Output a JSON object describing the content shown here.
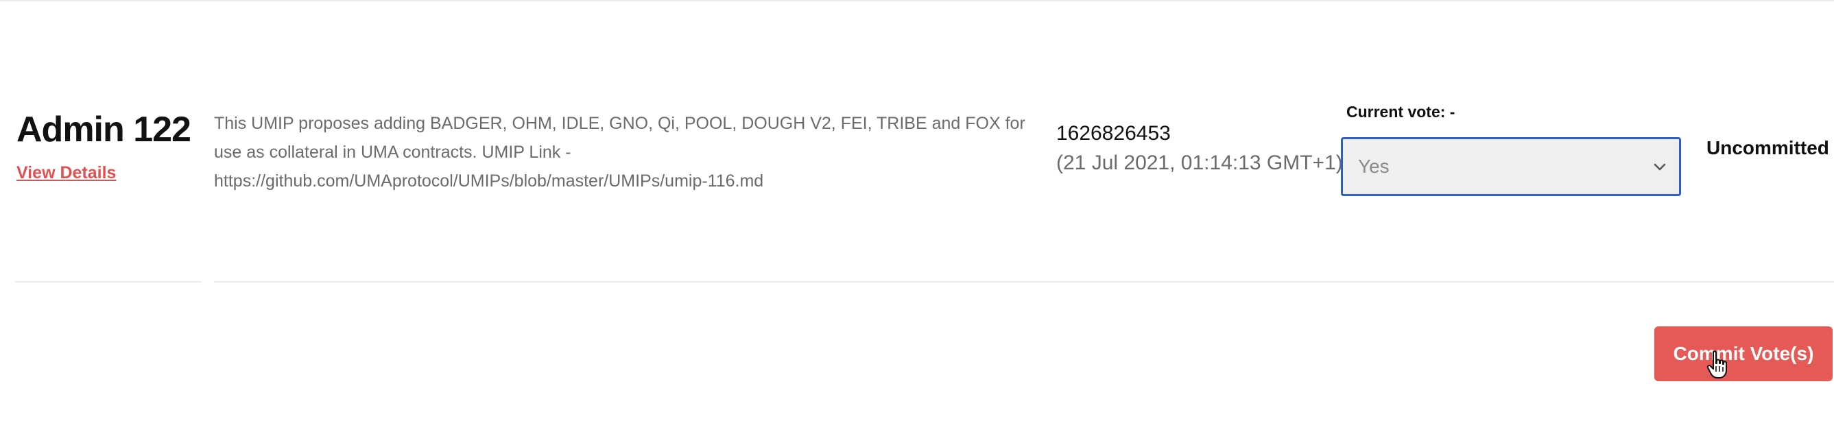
{
  "vote": {
    "title": "Admin 122",
    "view_details_label": "View Details",
    "description_lines": [
      "This UMIP proposes adding BADGER, OHM, IDLE, GNO, Qi, POOL, DOUGH V2, FEI, TRIBE and FOX for",
      "use as collateral in UMA contracts. UMIP Link -",
      "https://github.com/UMAprotocol/UMIPs/blob/master/UMIPs/umip-116.md"
    ],
    "timestamp": "1626826453",
    "timestamp_readable": "(21 Jul 2021, 01:14:13 GMT+1)",
    "current_vote_label": "Current vote: -",
    "selected_option": "Yes",
    "status": "Uncommitted"
  },
  "actions": {
    "commit_label": "Commit Vote(s)"
  },
  "colors": {
    "accent_red": "#e55a56",
    "link_red": "#e05252",
    "focus_blue": "#2f5fbf"
  },
  "icons": {
    "select": "chevron-down-icon",
    "cursor": "hand-pointer-icon"
  }
}
